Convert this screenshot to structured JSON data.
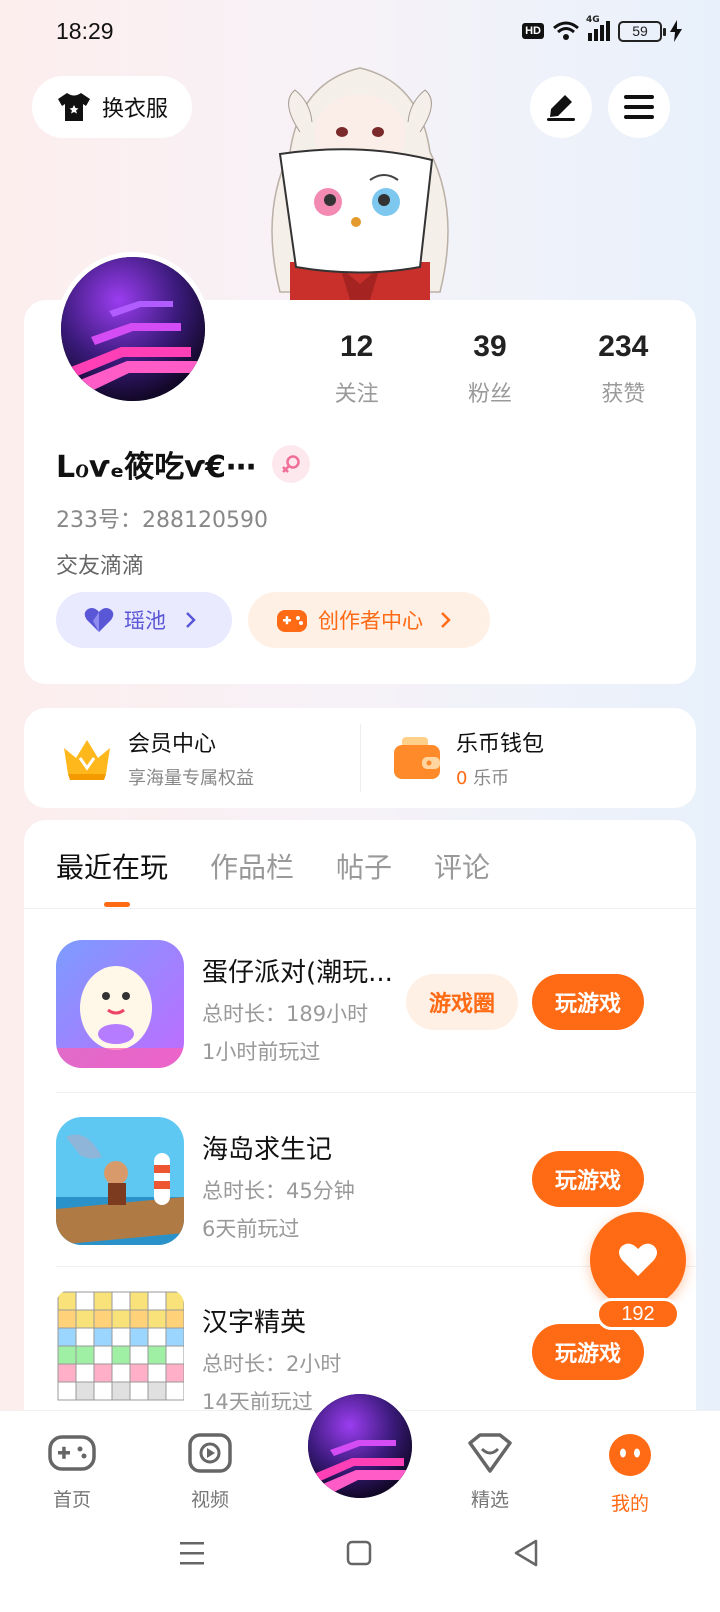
{
  "status_bar": {
    "time": "18:29",
    "hd": "HD",
    "network": "4G",
    "battery": "59"
  },
  "header": {
    "outfit_button": "换衣服"
  },
  "profile": {
    "stats": [
      {
        "value": "12",
        "label": "关注"
      },
      {
        "value": "39",
        "label": "粉丝"
      },
      {
        "value": "234",
        "label": "获赞"
      }
    ],
    "username": "Lℴѵₑ筱吃ѵ€⋯",
    "uid_label": "233号：",
    "uid": "288120590",
    "bio": "交友滴滴",
    "yaochi_label": "瑶池",
    "creator_label": "创作者中心"
  },
  "vip": {
    "member_title": "会员中心",
    "member_sub": "享海量专属权益",
    "wallet_title": "乐币钱包",
    "wallet_amount": "0",
    "wallet_unit": " 乐币"
  },
  "tabs": [
    "最近在玩",
    "作品栏",
    "帖子",
    "评论"
  ],
  "games": [
    {
      "name": "蛋仔派对(潮玩...",
      "duration": "总时长：189小时",
      "last_played": "1小时前玩过",
      "circle_label": "游戏圈",
      "play_label": "玩游戏"
    },
    {
      "name": "海岛求生记",
      "duration": "总时长：45分钟",
      "last_played": "6天前玩过",
      "play_label": "玩游戏"
    },
    {
      "name": "汉字精英",
      "duration": "总时长：2小时",
      "last_played": "14天前玩过",
      "play_label": "玩游戏"
    }
  ],
  "like": {
    "count": "192"
  },
  "bottom_nav": [
    {
      "label": "首页"
    },
    {
      "label": "视频"
    },
    {
      "label": "精选"
    },
    {
      "label": "我的"
    }
  ],
  "colors": {
    "accent": "#ff6a14",
    "yaochi": "#5a57d6"
  }
}
